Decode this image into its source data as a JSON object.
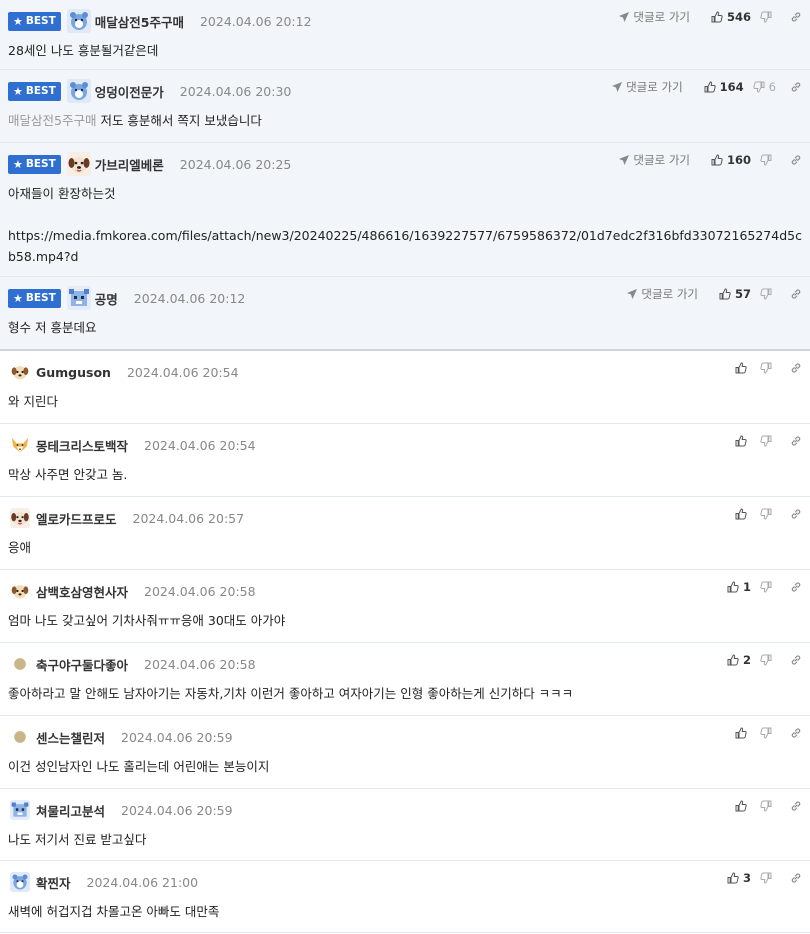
{
  "labels": {
    "best": "BEST",
    "reply_to_comment": "댓글로 가기"
  },
  "colors": {
    "best_badge": "#2f6fd1",
    "best_bg": "#f2f5fa"
  },
  "best_comments": [
    {
      "author": "매달삼전5주구매",
      "date": "2024.04.06 20:12",
      "avatar": "blue-bear-icon",
      "mention": "",
      "text": "28세인 나도 흥분될거같은데",
      "up": "546",
      "down": ""
    },
    {
      "author": "엉덩이전문가",
      "date": "2024.04.06 20:30",
      "avatar": "blue-bear-icon",
      "mention": "매달삼전5주구매",
      "text": "저도 흥분해서 쪽지 보냈습니다",
      "up": "164",
      "down": "6"
    },
    {
      "author": "가브리엘베론",
      "date": "2024.04.06 20:25",
      "avatar": "dog-face-icon",
      "mention": "",
      "text": "아재들이 환장하는것\n\nhttps://media.fmkorea.com/files/attach/new3/20240225/486616/1639227577/6759586372/01d7edc2f316bfd33072165274d5cb58.mp4?d",
      "up": "160",
      "down": ""
    },
    {
      "author": "공명",
      "date": "2024.04.06 20:12",
      "avatar": "blue-pixel-icon",
      "mention": "",
      "text": "형수 저 흥분데요",
      "up": "57",
      "down": ""
    }
  ],
  "comments": [
    {
      "author": "Gumguson",
      "date": "2024.04.06 20:54",
      "avatar": "puppy-face-icon",
      "text": "와 지린다",
      "up": "",
      "down": ""
    },
    {
      "author": "몽테크리스토백작",
      "date": "2024.04.06 20:54",
      "avatar": "fox-face-icon",
      "text": "막상 사주면 안갖고 놈.",
      "up": "",
      "down": ""
    },
    {
      "author": "엘로카드프로도",
      "date": "2024.04.06 20:57",
      "avatar": "dog-face-icon",
      "text": "응애",
      "up": "",
      "down": ""
    },
    {
      "author": "삼백호삼영현사자",
      "date": "2024.04.06 20:58",
      "avatar": "puppy-face-icon",
      "text": "엄마 나도 갖고싶어 기차사줘ㅠㅠ응애 30대도 아가야",
      "up": "1",
      "down": ""
    },
    {
      "author": "축구야구둘다좋아",
      "date": "2024.04.06 20:58",
      "avatar": "default-circle-icon",
      "text": "좋아하라고 말 안해도 남자아기는 자동차,기차 이런거 좋아하고 여자아기는 인형 좋아하는게 신기하다 ㅋㅋㅋ",
      "up": "2",
      "down": ""
    },
    {
      "author": "센스는챌린저",
      "date": "2024.04.06 20:59",
      "avatar": "default-circle-icon",
      "text": "이건 성인남자인 나도 홀리는데 어린애는 본능이지",
      "up": "",
      "down": ""
    },
    {
      "author": "쳐물리고분석",
      "date": "2024.04.06 20:59",
      "avatar": "blue-pixel-icon",
      "text": "나도 저기서 진료 받고싶다",
      "up": "",
      "down": ""
    },
    {
      "author": "확찐자",
      "date": "2024.04.06 21:00",
      "avatar": "blue-bear-icon",
      "text": "새벽에 허겁지겁 차몰고온 아빠도 대만족",
      "up": "3",
      "down": ""
    }
  ]
}
